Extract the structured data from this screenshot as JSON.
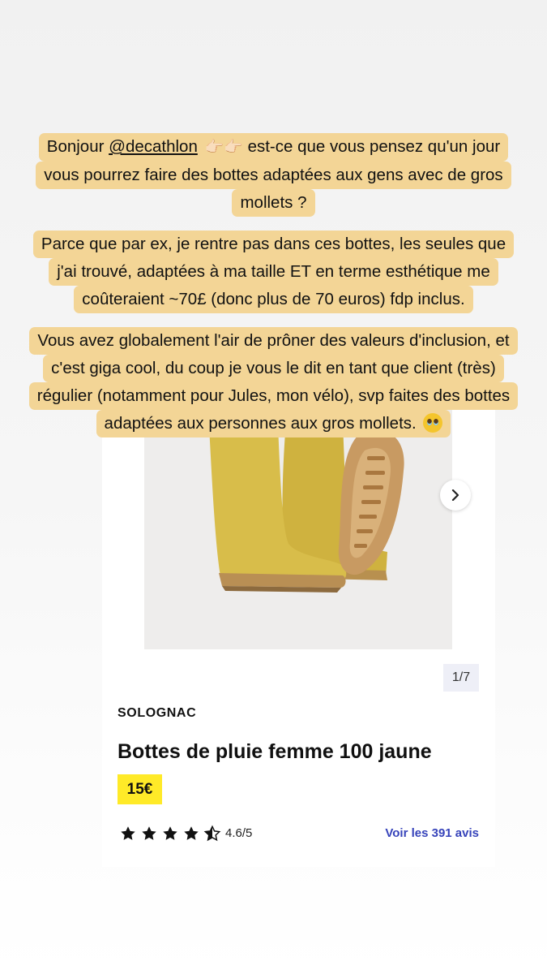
{
  "caption": {
    "paragraph1": {
      "line1_prefix": "Bonjour ",
      "mention": "@decathlon",
      "line1_suffix": " est-ce que vous pensez qu'un jour",
      "line2": "vous pourrez faire des bottes adaptées aux gens avec de gros",
      "line3": "mollets ?"
    },
    "paragraph2": {
      "line1": "Parce que par ex, je rentre pas dans ces bottes, les seules que",
      "line2": "j'ai trouvé, adaptées à ma taille ET en terme esthétique me",
      "line3": "coûteraient ~70£ (donc plus de 70 euros) fdp inclus."
    },
    "paragraph3": {
      "line1": "Vous avez globalement l'air de prôner des valeurs d'inclusion, et",
      "line2": "c'est giga cool, du coup je vous le dit en tant que client (très)",
      "line3": "régulier (notamment pour Jules, mon vélo), svp faites des bottes",
      "line4": "adaptées aux personnes aux gros mollets."
    },
    "hand_emoji": "👉🏻👉🏻",
    "face_icon": "pleading-face-icon",
    "highlight_color": "#f3d596"
  },
  "product": {
    "image_counter": "1/7",
    "brand": "SOLOGNAC",
    "title": "Bottes de pluie femme 100 jaune",
    "price": "15€",
    "price_highlight_color": "#ffea28",
    "rating_value": 4.6,
    "rating_text": "4.6/5",
    "reviews_link": "Voir les 391 avis",
    "link_color": "#3643ba",
    "boot_color": "#d8bd4a",
    "sole_color": "#c89a62"
  }
}
